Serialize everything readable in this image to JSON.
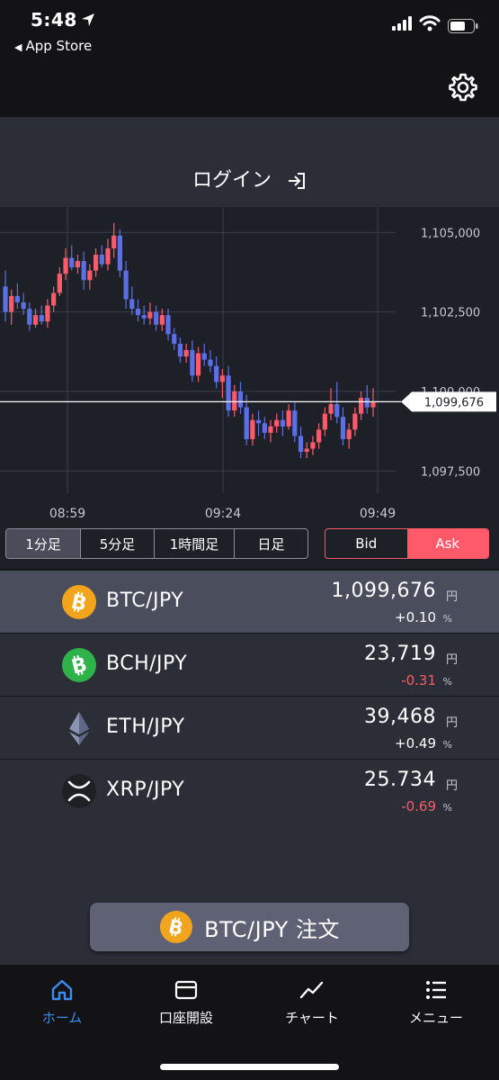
{
  "status": {
    "time": "5:48",
    "back_label": "App Store"
  },
  "header": {
    "login_label": "ログイン"
  },
  "chart_data": {
    "type": "candlestick",
    "yticks": [
      "1,105,000",
      "1,102,500",
      "1,100,000",
      "1,097,500"
    ],
    "ytick_values": [
      1105000,
      1102500,
      1100000,
      1097500
    ],
    "xticks": [
      "08:59",
      "09:24",
      "09:49"
    ],
    "current_price": 1099676,
    "current_price_label": "1,099,676",
    "ylim": [
      1096800,
      1105800
    ],
    "candles": [
      [
        1103300,
        1103800,
        1102200,
        1102500
      ],
      [
        1102500,
        1103200,
        1102100,
        1103000
      ],
      [
        1103000,
        1103400,
        1102600,
        1102800
      ],
      [
        1102800,
        1103100,
        1102400,
        1102600
      ],
      [
        1102600,
        1102800,
        1101900,
        1102100
      ],
      [
        1102100,
        1102600,
        1102000,
        1102400
      ],
      [
        1102400,
        1102700,
        1102100,
        1102200
      ],
      [
        1102200,
        1102900,
        1102000,
        1102700
      ],
      [
        1102700,
        1103300,
        1102500,
        1103100
      ],
      [
        1103100,
        1103900,
        1103000,
        1103700
      ],
      [
        1103700,
        1104500,
        1103500,
        1104200
      ],
      [
        1104200,
        1104600,
        1103800,
        1103900
      ],
      [
        1103900,
        1104300,
        1103700,
        1104100
      ],
      [
        1104100,
        1104400,
        1103200,
        1103500
      ],
      [
        1103500,
        1104000,
        1103200,
        1103800
      ],
      [
        1103800,
        1104500,
        1103600,
        1104300
      ],
      [
        1104300,
        1104600,
        1103900,
        1104000
      ],
      [
        1104000,
        1104800,
        1103800,
        1104500
      ],
      [
        1104500,
        1105300,
        1104200,
        1104900
      ],
      [
        1104900,
        1105100,
        1103600,
        1103800
      ],
      [
        1103800,
        1104100,
        1102600,
        1102900
      ],
      [
        1102900,
        1103300,
        1102400,
        1102600
      ],
      [
        1102600,
        1102900,
        1102200,
        1102400
      ],
      [
        1102400,
        1102700,
        1102100,
        1102300
      ],
      [
        1102300,
        1102800,
        1102100,
        1102500
      ],
      [
        1102500,
        1102700,
        1101900,
        1102100
      ],
      [
        1102100,
        1102600,
        1101900,
        1102400
      ],
      [
        1102400,
        1102600,
        1101600,
        1101800
      ],
      [
        1101800,
        1102000,
        1101300,
        1101500
      ],
      [
        1101500,
        1101700,
        1100900,
        1101100
      ],
      [
        1101100,
        1101500,
        1100900,
        1101300
      ],
      [
        1101300,
        1101600,
        1100300,
        1100500
      ],
      [
        1100500,
        1101400,
        1100300,
        1101200
      ],
      [
        1101200,
        1101500,
        1100800,
        1101000
      ],
      [
        1101000,
        1101300,
        1100600,
        1100800
      ],
      [
        1100800,
        1101100,
        1100100,
        1100300
      ],
      [
        1100300,
        1100700,
        1099800,
        1100500
      ],
      [
        1100500,
        1100800,
        1099200,
        1099400
      ],
      [
        1099400,
        1100200,
        1099200,
        1100000
      ],
      [
        1100000,
        1100300,
        1099300,
        1099500
      ],
      [
        1099500,
        1099900,
        1098300,
        1098500
      ],
      [
        1098500,
        1099300,
        1098300,
        1099100
      ],
      [
        1099100,
        1099400,
        1098600,
        1099000
      ],
      [
        1099000,
        1099200,
        1098500,
        1098700
      ],
      [
        1098700,
        1099100,
        1098400,
        1098900
      ],
      [
        1098900,
        1099300,
        1098700,
        1099100
      ],
      [
        1099100,
        1099400,
        1098600,
        1098900
      ],
      [
        1098900,
        1099600,
        1098800,
        1099400
      ],
      [
        1099400,
        1099700,
        1098400,
        1098600
      ],
      [
        1098600,
        1098900,
        1097900,
        1098100
      ],
      [
        1098100,
        1098400,
        1097900,
        1098200
      ],
      [
        1098200,
        1098600,
        1098000,
        1098400
      ],
      [
        1098400,
        1099000,
        1098200,
        1098800
      ],
      [
        1098800,
        1099500,
        1098600,
        1099300
      ],
      [
        1099300,
        1100100,
        1099100,
        1099600
      ],
      [
        1099600,
        1100300,
        1099000,
        1099200
      ],
      [
        1099200,
        1099500,
        1098300,
        1098500
      ],
      [
        1098500,
        1099000,
        1098200,
        1098800
      ],
      [
        1098800,
        1099500,
        1098600,
        1099300
      ],
      [
        1099300,
        1100000,
        1099100,
        1099800
      ],
      [
        1099800,
        1100200,
        1099300,
        1099500
      ],
      [
        1099500,
        1100100,
        1099200,
        1099676
      ]
    ]
  },
  "timeframes": [
    {
      "label": "1分足",
      "active": true
    },
    {
      "label": "5分足",
      "active": false
    },
    {
      "label": "1時間足",
      "active": false
    },
    {
      "label": "日足",
      "active": false
    }
  ],
  "bid_label": "Bid",
  "ask_label": "Ask",
  "pairs": [
    {
      "symbol": "BTC/JPY",
      "price": "1,099,676",
      "unit": "円",
      "change": "+0.10",
      "pct": "%",
      "dir": "pos",
      "icon": "bitcoin-icon",
      "color": "#f2a41c",
      "selected": true
    },
    {
      "symbol": "BCH/JPY",
      "price": "23,719",
      "unit": "円",
      "change": "-0.31",
      "pct": "%",
      "dir": "neg",
      "icon": "bitcoin-cash-icon",
      "color": "#2fb24a",
      "selected": false
    },
    {
      "symbol": "ETH/JPY",
      "price": "39,468",
      "unit": "円",
      "change": "+0.49",
      "pct": "%",
      "dir": "pos",
      "icon": "ethereum-icon",
      "color": "#8a93b2",
      "selected": false
    },
    {
      "symbol": "XRP/JPY",
      "price": "25.734",
      "unit": "円",
      "change": "-0.69",
      "pct": "%",
      "dir": "neg",
      "icon": "xrp-icon",
      "color": "#1f2024",
      "selected": false
    }
  ],
  "order_button": {
    "label": "BTC/JPY 注文"
  },
  "tabs": [
    {
      "label": "ホーム",
      "icon": "home-icon",
      "active": true
    },
    {
      "label": "口座開設",
      "icon": "card-icon",
      "active": false
    },
    {
      "label": "チャート",
      "icon": "chart-line-icon",
      "active": false
    },
    {
      "label": "メニュー",
      "icon": "list-icon",
      "active": false
    }
  ],
  "colors": {
    "up": "#ff5a6a",
    "down": "#5b70e6",
    "accent": "#3b8cf2"
  }
}
